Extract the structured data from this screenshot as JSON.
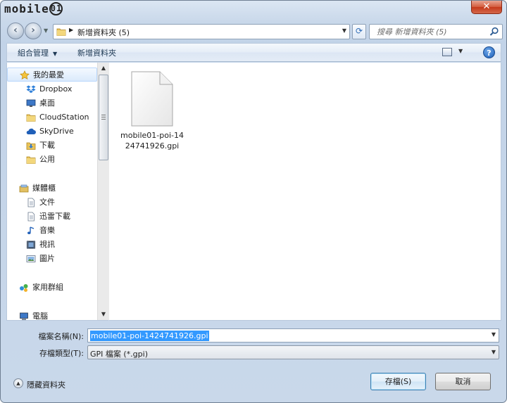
{
  "titlebar": {
    "logo_text": "mobile",
    "logo_mark": "01",
    "close_label": "✕"
  },
  "address": {
    "path": "新增資料夾 (5)"
  },
  "search": {
    "placeholder": "搜尋 新增資料夾 (5)"
  },
  "toolbar": {
    "organize_label": "組合管理",
    "new_folder_label": "新增資料夾",
    "help_label": "?"
  },
  "nav": {
    "favorites_label": "我的最愛",
    "favorites": [
      {
        "label": "Dropbox",
        "icon": "dropbox-icon"
      },
      {
        "label": "桌面",
        "icon": "desktop-icon"
      },
      {
        "label": "CloudStation",
        "icon": "folder-icon"
      },
      {
        "label": "SkyDrive",
        "icon": "skydrive-icon"
      },
      {
        "label": "下載",
        "icon": "downloads-icon"
      },
      {
        "label": "公用",
        "icon": "folder-icon"
      }
    ],
    "libraries_label": "媒體櫃",
    "libraries": [
      {
        "label": "文件",
        "icon": "document-icon"
      },
      {
        "label": "迅雷下載",
        "icon": "document-icon"
      },
      {
        "label": "音樂",
        "icon": "music-icon"
      },
      {
        "label": "視訊",
        "icon": "video-icon"
      },
      {
        "label": "圖片",
        "icon": "picture-icon"
      }
    ],
    "homegroup_label": "家用群組",
    "computer_label": "電腦"
  },
  "files": [
    {
      "name": "mobile01-poi-1424741926.gpi",
      "icon": "blank-file-icon"
    }
  ],
  "form": {
    "filename_label": "檔案名稱(N):",
    "filename_value": "mobile01-poi-1424741926.gpi",
    "filetype_label": "存檔類型(T):",
    "filetype_value": "GPI 檔案 (*.gpi)"
  },
  "footer": {
    "hide_folders_label": "隱藏資料夾",
    "save_label": "存檔(S)",
    "cancel_label": "取消"
  },
  "colors": {
    "selection": "#3399ff",
    "frame": "#c9d8ea",
    "close": "#c5391b"
  }
}
